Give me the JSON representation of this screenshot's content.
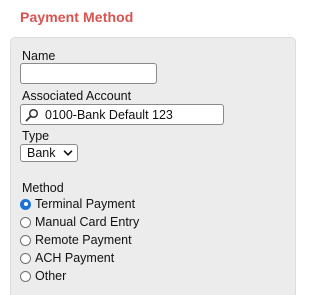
{
  "section": {
    "title": "Payment Method"
  },
  "form": {
    "name": {
      "label": "Name",
      "value": ""
    },
    "account": {
      "label": "Associated Account",
      "icon": "search-icon",
      "value": "0100-Bank Default 123"
    },
    "type": {
      "label": "Type",
      "selected": "Bank"
    },
    "method": {
      "label": "Method",
      "options": [
        {
          "label": "Terminal Payment",
          "checked": true
        },
        {
          "label": "Manual Card Entry",
          "checked": false
        },
        {
          "label": "Remote Payment",
          "checked": false
        },
        {
          "label": "ACH Payment",
          "checked": false
        },
        {
          "label": "Other",
          "checked": false
        }
      ]
    }
  },
  "colors": {
    "title": "#d9534f",
    "panel": "#ececec",
    "radio_selected": "#1f73d6"
  }
}
